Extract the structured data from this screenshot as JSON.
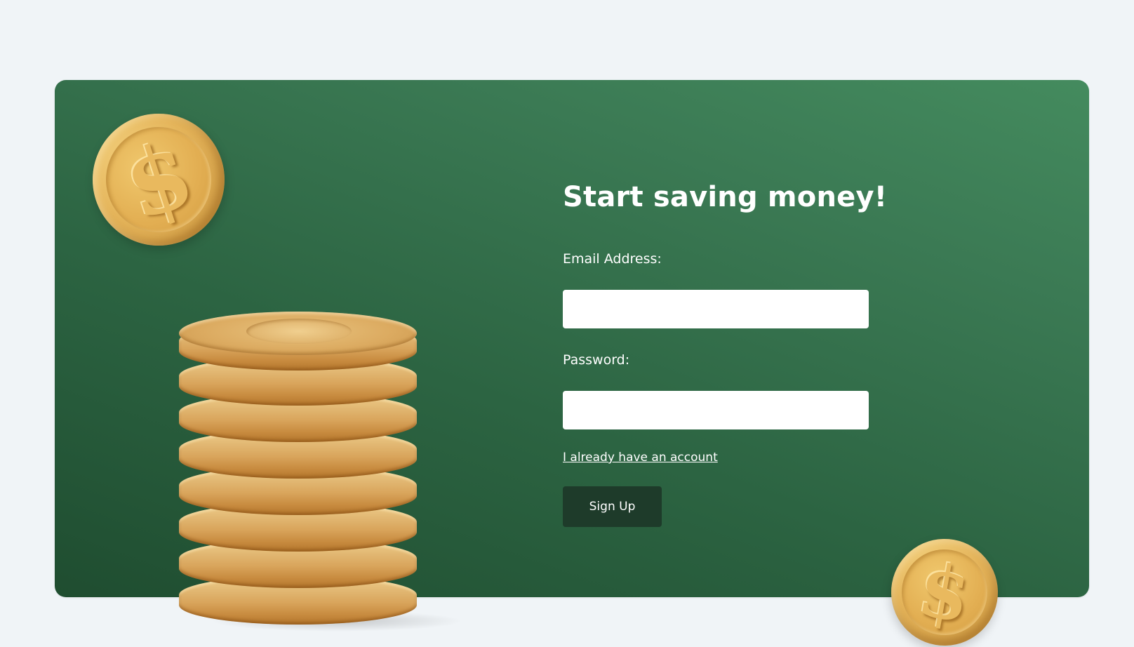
{
  "signup": {
    "title": "Start saving money!",
    "email_label": "Email Address:",
    "email_value": "",
    "password_label": "Password:",
    "password_value": "",
    "login_link": "I already have an account",
    "submit_label": "Sign Up"
  },
  "decor": {
    "coin_symbol": "$",
    "icons": [
      "dollar-coin-icon",
      "dollar-coin-icon",
      "coin-stack-icon"
    ],
    "colors": {
      "card_gradient_start": "#1f4d30",
      "card_gradient_end": "#448b5e",
      "button": "#1e3b2a",
      "page_background": "#f0f4f7",
      "coin_gold": "#e4b45a"
    }
  }
}
